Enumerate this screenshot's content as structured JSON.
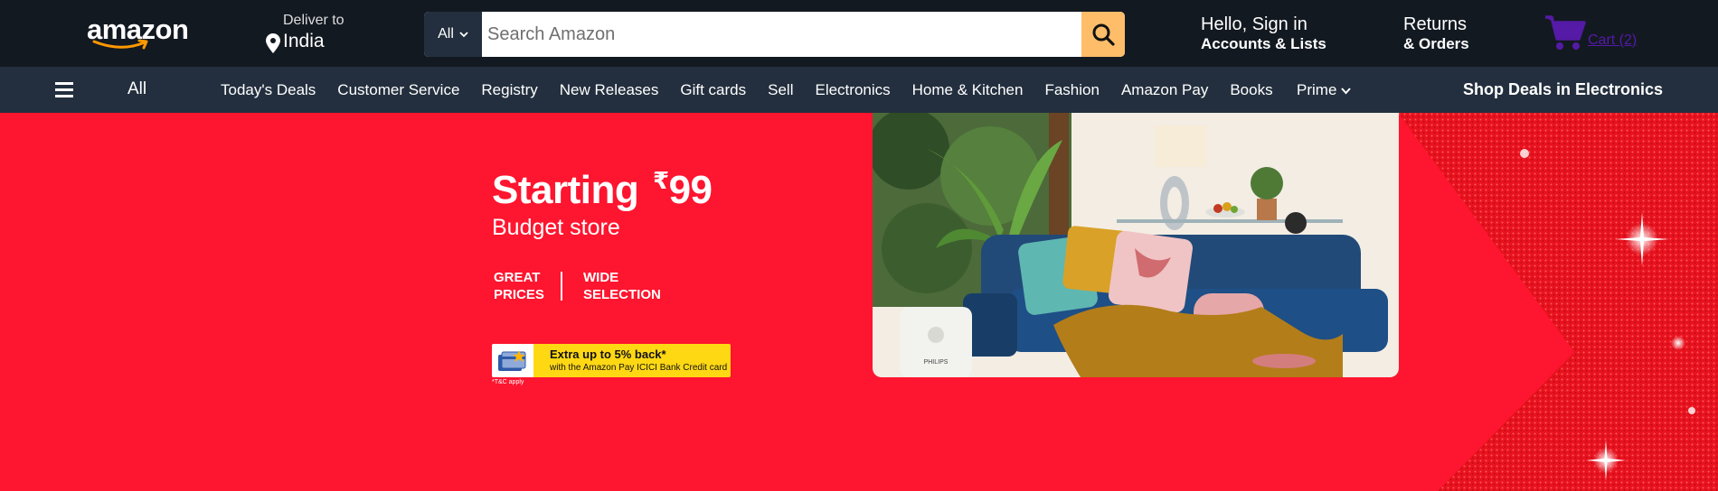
{
  "header": {
    "logo_text": "amazon",
    "deliver_label": "Deliver to",
    "deliver_location": "India",
    "search": {
      "category": "All",
      "placeholder": "Search Amazon"
    },
    "account": {
      "greeting": "Hello, Sign in",
      "menu": "Accounts & Lists"
    },
    "returns": {
      "line1": "Returns",
      "line2": "& Orders"
    },
    "cart": {
      "label": "Cart (2)"
    }
  },
  "nav": {
    "all_label": "All",
    "links": [
      "Today's Deals",
      "Customer Service",
      "Registry",
      "New Releases",
      "Gift cards",
      "Sell",
      "Electronics",
      "Home & Kitchen",
      "Fashion",
      "Amazon Pay",
      "Books"
    ],
    "prime_label": "Prime",
    "promo_label": "Shop Deals in Electronics"
  },
  "hero": {
    "headline": "Starting",
    "price_symbol": "₹",
    "price": "99",
    "subtitle": "Budget store",
    "feature1": "GREAT PRICES",
    "feature2": "WIDE SELECTION",
    "card_offer_title": "Extra up to 5% back*",
    "card_offer_sub": "with the Amazon Pay ICICI Bank Credit card",
    "terms": "*T&C apply",
    "photo_brand": "PHILIPS"
  },
  "colors": {
    "header_bg": "#131921",
    "nav_bg": "#232f3e",
    "search_button": "#febd69",
    "hero_bg": "#fe152f",
    "cart_accent": "#551aa6"
  }
}
